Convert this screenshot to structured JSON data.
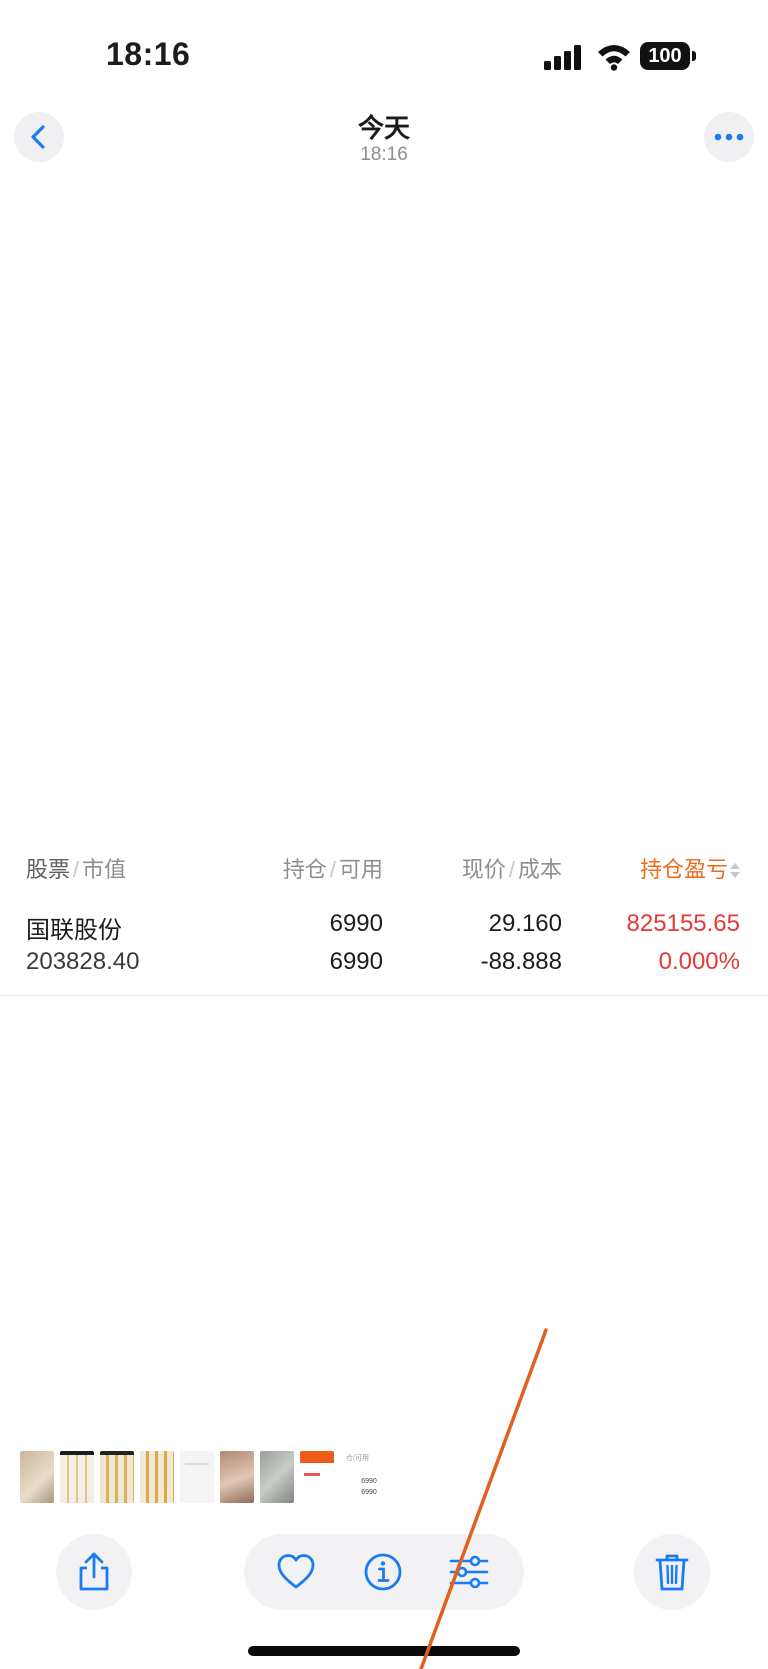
{
  "status_bar": {
    "time": "18:16",
    "battery": "100"
  },
  "nav": {
    "title": "今天",
    "subtitle": "18:16",
    "back_icon": "chevron-left-icon",
    "more_icon": "ellipsis-icon"
  },
  "stock_table": {
    "headers": {
      "stock": "股票",
      "market_value": "市值",
      "position": "持仓",
      "available": "可用",
      "price": "现价",
      "cost": "成本",
      "pnl": "持仓盈亏"
    },
    "row": {
      "name": "国联股份",
      "market_value": "203828.40",
      "position": "6990",
      "available": "6990",
      "price": "29.160",
      "cost": "-88.888",
      "pnl": "825155.65",
      "pnl_pct": "0.000%"
    },
    "colors": {
      "accent": "#f06a1d",
      "gain": "#e53935"
    }
  },
  "thumbnail_strip": {
    "last_thumb": {
      "label": "仓/可用",
      "v1": "6990",
      "v2": "6990"
    }
  },
  "toolbar": {
    "share_icon": "share-icon",
    "favorite_icon": "heart-icon",
    "info_icon": "info-icon",
    "adjust_icon": "sliders-icon",
    "delete_icon": "trash-icon",
    "tint": "#1a7cf5"
  }
}
